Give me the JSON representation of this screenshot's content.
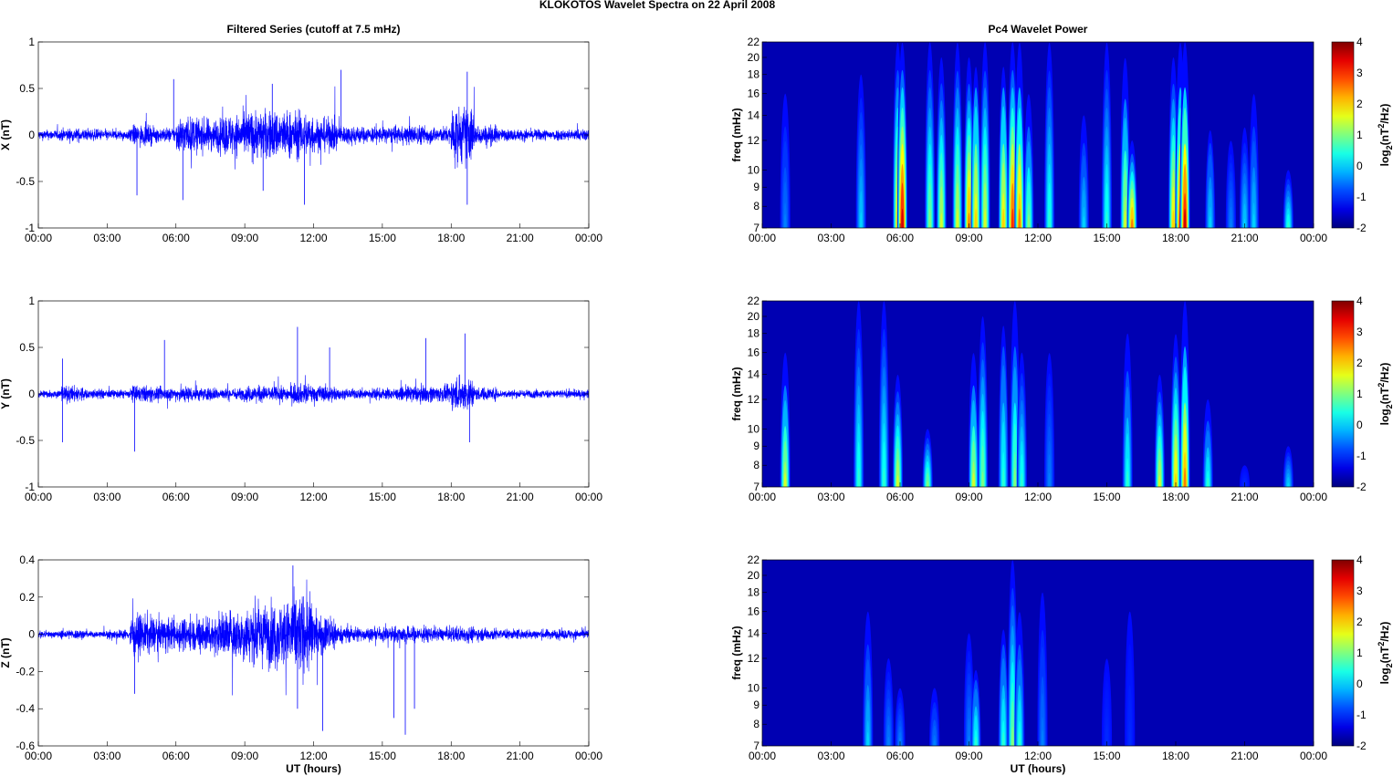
{
  "figure_title": "KLOKOTOS Wavelet Spectra on 22 April     2008",
  "chart_data": [
    {
      "type": "line",
      "panel": "X",
      "title": "Filtered Series (cutoff at 7.5 mHz)",
      "ylabel": "X (nT)",
      "xlabel": "",
      "xlim_hours": [
        0,
        24
      ],
      "ylim": [
        -1,
        1
      ],
      "yticks": [
        -1,
        -0.5,
        0,
        0.5,
        1
      ],
      "xticks": [
        "00:00",
        "03:00",
        "06:00",
        "09:00",
        "12:00",
        "15:00",
        "18:00",
        "21:00",
        "00:00"
      ],
      "envelope_nT_per_hour": [
        0.06,
        0.08,
        0.07,
        0.06,
        0.12,
        0.09,
        0.22,
        0.2,
        0.25,
        0.3,
        0.3,
        0.28,
        0.2,
        0.12,
        0.1,
        0.1,
        0.12,
        0.1,
        0.35,
        0.12,
        0.07,
        0.07,
        0.07,
        0.07
      ],
      "spikes": [
        [
          4.3,
          -0.65
        ],
        [
          5.9,
          0.6
        ],
        [
          6.3,
          -0.7
        ],
        [
          9.8,
          -0.6
        ],
        [
          11.6,
          -0.75
        ],
        [
          13.2,
          0.7
        ],
        [
          18.7,
          0.68
        ],
        [
          18.7,
          -0.75
        ],
        [
          10.2,
          0.55
        ]
      ]
    },
    {
      "type": "line",
      "panel": "Y",
      "title": "",
      "ylabel": "Y (nT)",
      "xlabel": "",
      "xlim_hours": [
        0,
        24
      ],
      "ylim": [
        -1,
        1
      ],
      "yticks": [
        -1,
        -0.5,
        0,
        0.5,
        1
      ],
      "xticks": [
        "00:00",
        "03:00",
        "06:00",
        "09:00",
        "12:00",
        "15:00",
        "18:00",
        "21:00",
        "00:00"
      ],
      "envelope_nT_per_hour": [
        0.05,
        0.1,
        0.06,
        0.05,
        0.1,
        0.08,
        0.1,
        0.08,
        0.07,
        0.1,
        0.09,
        0.12,
        0.1,
        0.06,
        0.07,
        0.07,
        0.1,
        0.1,
        0.2,
        0.08,
        0.05,
        0.05,
        0.05,
        0.05
      ],
      "spikes": [
        [
          1.05,
          0.38
        ],
        [
          1.05,
          -0.52
        ],
        [
          4.2,
          -0.62
        ],
        [
          5.5,
          0.58
        ],
        [
          11.3,
          0.72
        ],
        [
          12.7,
          0.5
        ],
        [
          16.9,
          0.6
        ],
        [
          18.6,
          0.65
        ],
        [
          18.8,
          -0.52
        ]
      ]
    },
    {
      "type": "line",
      "panel": "Z",
      "title": "",
      "ylabel": "Z (nT)",
      "xlabel": "UT (hours)",
      "xlim_hours": [
        0,
        24
      ],
      "ylim": [
        -0.6,
        0.4
      ],
      "yticks": [
        -0.6,
        -0.4,
        -0.2,
        0,
        0.2,
        0.4
      ],
      "xticks": [
        "00:00",
        "03:00",
        "06:00",
        "09:00",
        "12:00",
        "15:00",
        "18:00",
        "21:00",
        "00:00"
      ],
      "envelope_nT_per_hour": [
        0.02,
        0.03,
        0.02,
        0.03,
        0.12,
        0.1,
        0.1,
        0.12,
        0.15,
        0.18,
        0.2,
        0.25,
        0.12,
        0.05,
        0.04,
        0.05,
        0.05,
        0.04,
        0.05,
        0.04,
        0.03,
        0.03,
        0.03,
        0.03
      ],
      "spikes": [
        [
          11.1,
          0.37
        ],
        [
          11.3,
          -0.4
        ],
        [
          12.4,
          -0.52
        ],
        [
          15.5,
          -0.45
        ],
        [
          16.0,
          -0.54
        ],
        [
          16.4,
          -0.4
        ],
        [
          4.2,
          -0.32
        ]
      ]
    },
    {
      "type": "heatmap",
      "panel": "X",
      "title": "Pc4 Wavelet Power",
      "ylabel": "freq (mHz)",
      "xlabel": "",
      "ylim_mHz": [
        7,
        22
      ],
      "yticks": [
        7,
        8,
        9,
        10,
        12,
        14,
        16,
        18,
        20,
        22
      ],
      "colorbar_label": "log2(nT^2/Hz)",
      "clim": [
        -2,
        4
      ],
      "cticks": [
        -2,
        -1,
        0,
        1,
        2,
        3,
        4
      ],
      "xticks": [
        "00:00",
        "03:00",
        "06:00",
        "09:00",
        "12:00",
        "15:00",
        "18:00",
        "21:00",
        "00:00"
      ],
      "events_hour_fmax_power": [
        [
          1.0,
          16,
          -0.5
        ],
        [
          4.3,
          18,
          0
        ],
        [
          5.9,
          22,
          2
        ],
        [
          6.1,
          22,
          3.5
        ],
        [
          7.3,
          22,
          1
        ],
        [
          7.8,
          20,
          1.5
        ],
        [
          8.5,
          22,
          1.5
        ],
        [
          9.0,
          20,
          2.5
        ],
        [
          9.3,
          22,
          2
        ],
        [
          9.7,
          22,
          1.5
        ],
        [
          10.5,
          22,
          2
        ],
        [
          10.9,
          22,
          3
        ],
        [
          11.2,
          22,
          2.5
        ],
        [
          11.6,
          16,
          1
        ],
        [
          12.5,
          22,
          0.5
        ],
        [
          14.0,
          14,
          0
        ],
        [
          15.0,
          22,
          0.5
        ],
        [
          15.8,
          20,
          1.5
        ],
        [
          16.1,
          12,
          2.5
        ],
        [
          17.9,
          20,
          2
        ],
        [
          18.2,
          22,
          3
        ],
        [
          18.4,
          22,
          3.5
        ],
        [
          19.5,
          14,
          0
        ],
        [
          20.4,
          12,
          -0.5
        ],
        [
          21.0,
          13,
          0
        ],
        [
          21.4,
          16,
          0
        ],
        [
          22.9,
          10,
          0.5
        ]
      ]
    },
    {
      "type": "heatmap",
      "panel": "Y",
      "title": "",
      "ylabel": "freq (mHz)",
      "xlabel": "",
      "ylim_mHz": [
        7,
        22
      ],
      "yticks": [
        7,
        8,
        9,
        10,
        12,
        14,
        16,
        18,
        20,
        22
      ],
      "colorbar_label": "log2(nT^2/Hz)",
      "clim": [
        -2,
        4
      ],
      "cticks": [
        -2,
        -1,
        0,
        1,
        2,
        3,
        4
      ],
      "xticks": [
        "00:00",
        "03:00",
        "06:00",
        "09:00",
        "12:00",
        "15:00",
        "18:00",
        "21:00",
        "00:00"
      ],
      "events_hour_fmax_power": [
        [
          1.0,
          16,
          1.5
        ],
        [
          4.2,
          22,
          0.5
        ],
        [
          5.3,
          22,
          0.5
        ],
        [
          5.9,
          14,
          1.5
        ],
        [
          7.2,
          10,
          1
        ],
        [
          9.2,
          16,
          1.5
        ],
        [
          9.6,
          20,
          1
        ],
        [
          10.5,
          22,
          0.5
        ],
        [
          11.0,
          22,
          1
        ],
        [
          11.3,
          16,
          0.5
        ],
        [
          12.5,
          16,
          -0.5
        ],
        [
          15.9,
          18,
          0.5
        ],
        [
          17.3,
          14,
          1.5
        ],
        [
          18.0,
          18,
          2
        ],
        [
          18.4,
          22,
          2.5
        ],
        [
          19.4,
          12,
          0.5
        ],
        [
          21.0,
          8,
          -1
        ],
        [
          22.9,
          9,
          0
        ]
      ]
    },
    {
      "type": "heatmap",
      "panel": "Z",
      "title": "",
      "ylabel": "freq (mHz)",
      "xlabel": "UT (hours)",
      "ylim_mHz": [
        7,
        22
      ],
      "yticks": [
        7,
        8,
        9,
        10,
        12,
        14,
        16,
        18,
        20,
        22
      ],
      "colorbar_label": "log2(nT^2/Hz)",
      "clim": [
        -2,
        4
      ],
      "cticks": [
        -2,
        -1,
        0,
        1,
        2,
        3,
        4
      ],
      "xticks": [
        "00:00",
        "03:00",
        "06:00",
        "09:00",
        "12:00",
        "15:00",
        "18:00",
        "21:00",
        "00:00"
      ],
      "events_hour_fmax_power": [
        [
          4.6,
          16,
          0
        ],
        [
          5.5,
          12,
          -0.5
        ],
        [
          6.0,
          10,
          -0.5
        ],
        [
          7.5,
          10,
          -0.5
        ],
        [
          9.0,
          14,
          -0.5
        ],
        [
          9.3,
          12,
          0.5
        ],
        [
          10.5,
          16,
          0.5
        ],
        [
          10.9,
          22,
          1
        ],
        [
          11.2,
          16,
          0.5
        ],
        [
          12.2,
          18,
          -0.5
        ],
        [
          15.0,
          12,
          -1
        ],
        [
          16.0,
          16,
          -1
        ]
      ]
    }
  ]
}
